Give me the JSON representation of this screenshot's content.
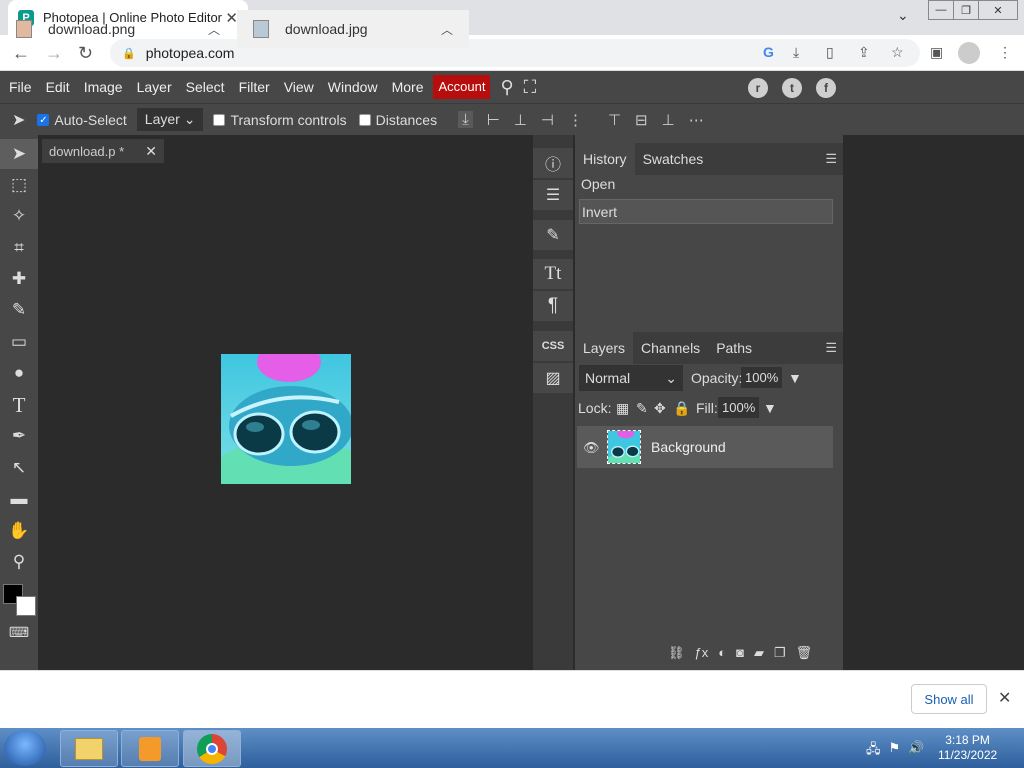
{
  "browser": {
    "tab_title": "Photopea | Online Photo Editor",
    "favicon": "P",
    "url": "photopea.com"
  },
  "menu": {
    "items": [
      "File",
      "Edit",
      "Image",
      "Layer",
      "Select",
      "Filter",
      "View",
      "Window",
      "More"
    ],
    "account": "Account"
  },
  "options": {
    "auto_select": "Auto-Select",
    "target": "Layer",
    "transform_controls": "Transform controls",
    "distances": "Distances"
  },
  "document": {
    "tab": "download.p *"
  },
  "history": {
    "tab": "History",
    "tab2": "Swatches",
    "entries": [
      "Open",
      "Invert"
    ]
  },
  "layers": {
    "tabs": [
      "Layers",
      "Channels",
      "Paths"
    ],
    "blend": "Normal",
    "opacity_label": "Opacity:",
    "opacity": "100%",
    "lock_label": "Lock:",
    "fill_label": "Fill:",
    "fill": "100%",
    "layer_name": "Background"
  },
  "css_label": "CSS",
  "downloads": {
    "items": [
      "download.png",
      "download.jpg"
    ],
    "show_all": "Show all"
  },
  "taskbar": {
    "time": "3:18 PM",
    "date": "11/23/2022"
  },
  "colors": {
    "account_red": "#b80d0d",
    "panel_bg": "#474747"
  }
}
